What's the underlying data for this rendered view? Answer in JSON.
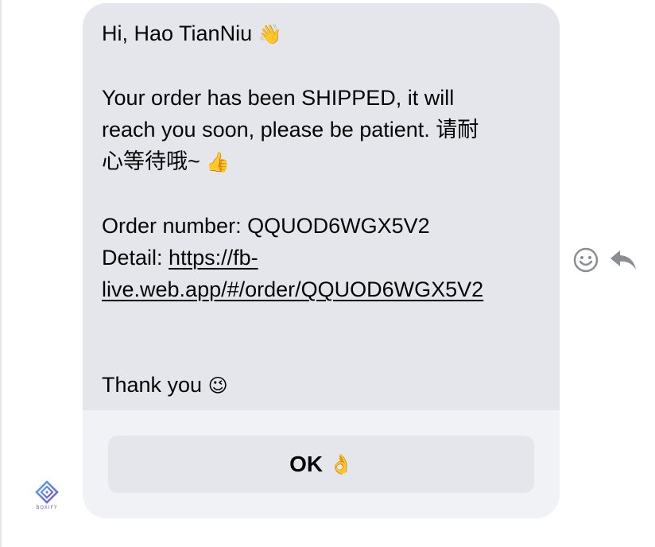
{
  "message": {
    "greeting": "Hi, Hao TianNiu",
    "greeting_emoji": "👋",
    "shipped_line1": "Your order has been SHIPPED, it will",
    "shipped_line2": "reach you soon, please be patient. 请耐",
    "shipped_line3": "心等待哦~",
    "shipped_emoji": "👍",
    "order_number_line": "Order number: QQUOD6WGX5V2",
    "detail_label": "Detail:",
    "detail_link_part1": "https://fb-",
    "detail_link_part2": "live.web.app/#/order/QQUOD6WGX5V2",
    "thanks": "Thank you",
    "thanks_emoji": "😉"
  },
  "quick_reply": {
    "label": "OK",
    "emoji": "👌"
  },
  "actions": {
    "react_icon": "smiley-face-icon",
    "reply_icon": "reply-arrow-icon"
  },
  "sender": {
    "brand": "BOXIFY",
    "icon": "boxify-logo-icon"
  },
  "colors": {
    "bubble": "#e4e6eb",
    "text": "#050505",
    "icon": "#8a8d91"
  }
}
